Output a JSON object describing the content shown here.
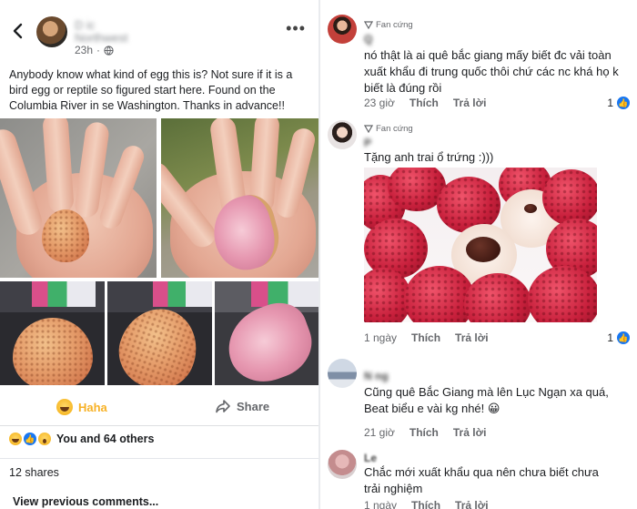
{
  "left_post": {
    "author_line1": "D                 ic",
    "author_line2": "Northwest",
    "time": "23h",
    "text": "Anybody know what kind of egg this is?  Not sure if it is a bird egg or reptile so figured start here.  Found on the Columbia River in  se Washington.  Thanks in advance!!",
    "haha_label": "Haha",
    "share_label": "Share",
    "reactions_text": "You and 64 others",
    "shares_text": "12 shares",
    "view_previous": "View previous comments..."
  },
  "comments": [
    {
      "badge": "Fan cứng",
      "name": "Q",
      "text": "nó thật là ai quê bắc giang mấy biết đc vải toàn xuất khẩu đi trung quốc thôi chứ các nc khá họ k biết là đúng rồi",
      "time": "23 giờ",
      "like": "Thích",
      "reply": "Trả lời",
      "likes_count": "1"
    },
    {
      "badge": "Fan cứng",
      "name": "P",
      "text": "Tặng anh trai ổ trứng :)))",
      "time": "1 ngày",
      "like": "Thích",
      "reply": "Trả lời",
      "likes_count": "1"
    },
    {
      "name": "N                ng",
      "text": "Cũng quê Bắc Giang mà lên Lục Ngạn xa quá, Beat biểu e vài kg nhé! 😀",
      "time": "21 giờ",
      "like": "Thích",
      "reply": "Trả lời"
    },
    {
      "name": "Le",
      "text": "Chắc mới xuất khẩu qua nên chưa biết chưa trải nghiệm",
      "time": "1 ngày",
      "like": "Thích",
      "reply": "Trả lời"
    }
  ],
  "colors": {
    "haha": "#f7b125",
    "link_blue": "#1877f2",
    "meta_gray": "#65676b"
  },
  "icons": [
    "back-arrow-icon",
    "globe-icon",
    "more-dots-icon",
    "haha-emoji-icon",
    "share-arrow-icon",
    "like-icon",
    "wow-emoji-icon",
    "fan-badge-icon"
  ]
}
